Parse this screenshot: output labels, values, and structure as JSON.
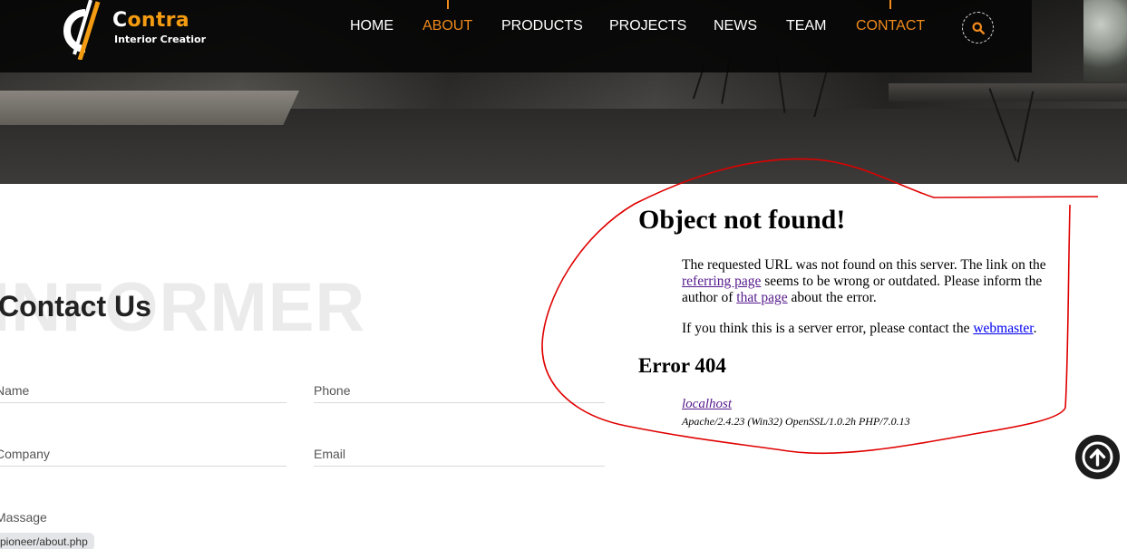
{
  "brand": {
    "name_first": "C",
    "name_rest": "ontra",
    "tagline": "Interior Creatior"
  },
  "nav": {
    "items": [
      {
        "label": "HOME",
        "active": false
      },
      {
        "label": "ABOUT",
        "active": true
      },
      {
        "label": "PRODUCTS",
        "active": false
      },
      {
        "label": "PROJECTS",
        "active": false
      },
      {
        "label": "NEWS",
        "active": false
      },
      {
        "label": "TEAM",
        "active": false
      },
      {
        "label": "CONTACT",
        "active": true
      }
    ],
    "search_icon": "search-icon",
    "accent_color": "#f08a1c"
  },
  "contact": {
    "watermark": "INFORMER",
    "title": "Contact Us",
    "fields": {
      "name": "Name",
      "phone": "Phone",
      "company": "Company",
      "email": "Email",
      "message": "Massage"
    }
  },
  "status_url": "pioneer/about.php",
  "error": {
    "title": "Object not found!",
    "p1_before": "The requested URL was not found on this server. The link on the",
    "p1_link1": "referring page",
    "p1_middle": "seems to be wrong or outdated. Please inform the author of",
    "p1_link2": "that page",
    "p1_after": "about the error.",
    "p2_before": "If you think this is a server error, please contact the",
    "p2_link": "webmaster",
    "p2_after": ".",
    "code": "Error 404",
    "host": "localhost",
    "server": "Apache/2.4.23 (Win32) OpenSSL/1.0.2h PHP/7.0.13"
  },
  "annotation_color": "#e00000",
  "scroll_top_icon": "arrow-up-circle-icon"
}
